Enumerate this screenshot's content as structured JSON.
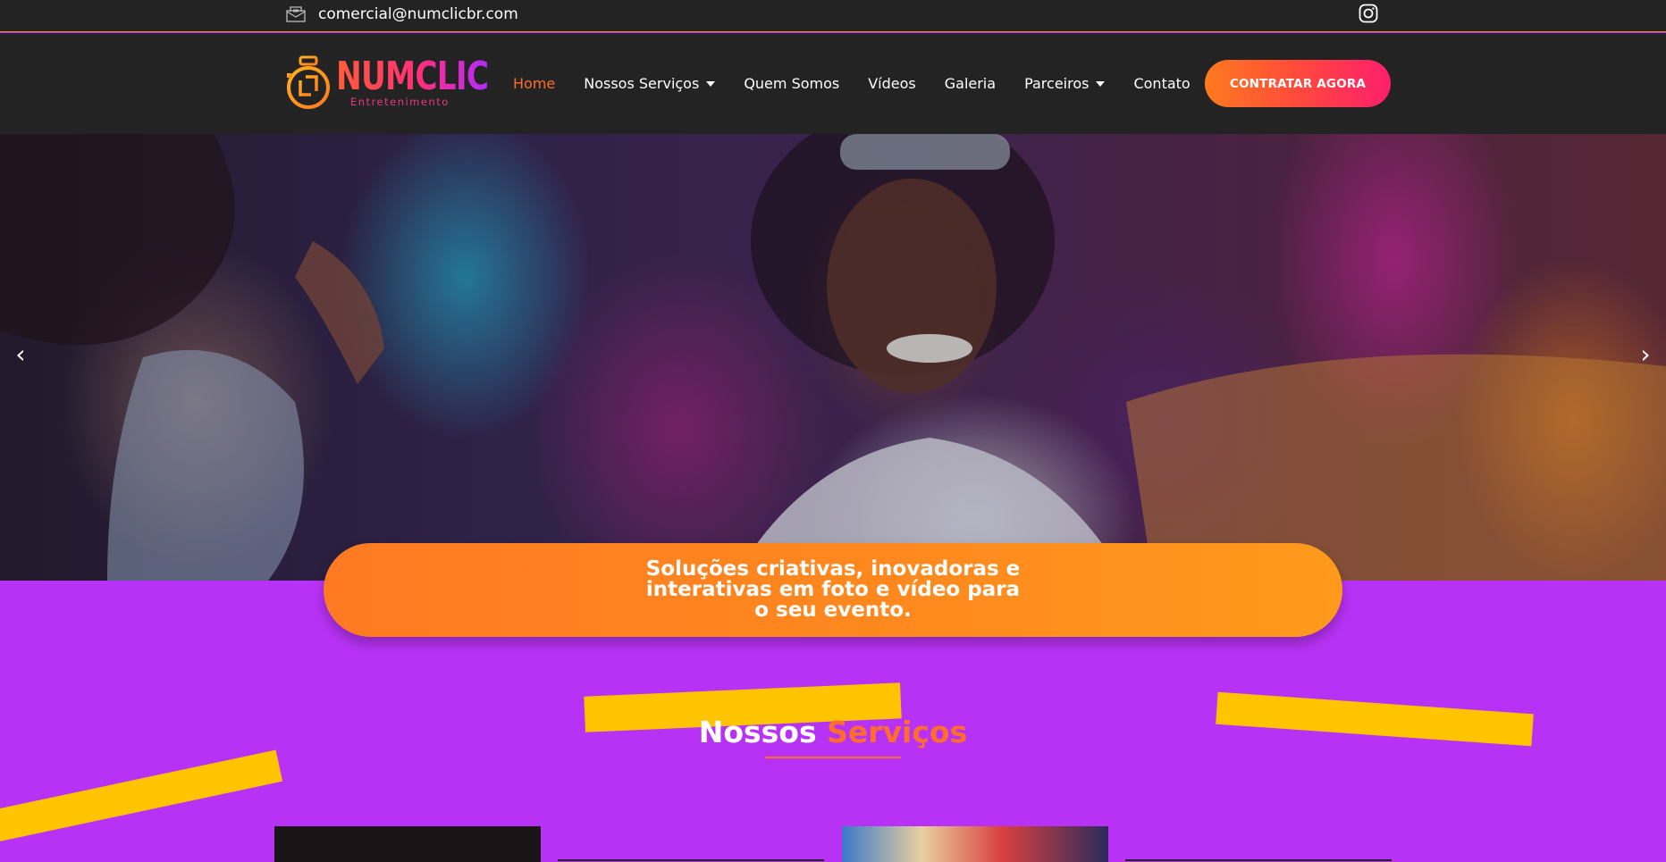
{
  "topbar": {
    "email": "comercial@numclicbr.com",
    "email_icon": "envelope-icon",
    "social_icon": "instagram-icon"
  },
  "nav": {
    "logo": {
      "word": "NUMCLIC",
      "sub": "Entretenimento"
    },
    "items": [
      {
        "label": "Home",
        "active": true,
        "dropdown": false
      },
      {
        "label": "Nossos Serviços",
        "active": false,
        "dropdown": true
      },
      {
        "label": "Quem Somos",
        "active": false,
        "dropdown": false
      },
      {
        "label": "Vídeos",
        "active": false,
        "dropdown": false
      },
      {
        "label": "Galeria",
        "active": false,
        "dropdown": false
      },
      {
        "label": "Parceiros",
        "active": false,
        "dropdown": true
      },
      {
        "label": "Contato",
        "active": false,
        "dropdown": false
      }
    ],
    "cta": "CONTRATAR AGORA"
  },
  "hero": {
    "prev_icon": "chevron-left-icon",
    "next_icon": "chevron-right-icon",
    "tagline": "Soluções criativas, inovadoras e interativas em foto e vídeo para o seu evento."
  },
  "services": {
    "title_white": "Nossos",
    "title_accent": "Serviços"
  },
  "colors": {
    "accent_orange": "#ff6d2e",
    "background_purple": "#b832f6",
    "stroke_yellow": "#ffc400",
    "header_dark": "#232323"
  }
}
